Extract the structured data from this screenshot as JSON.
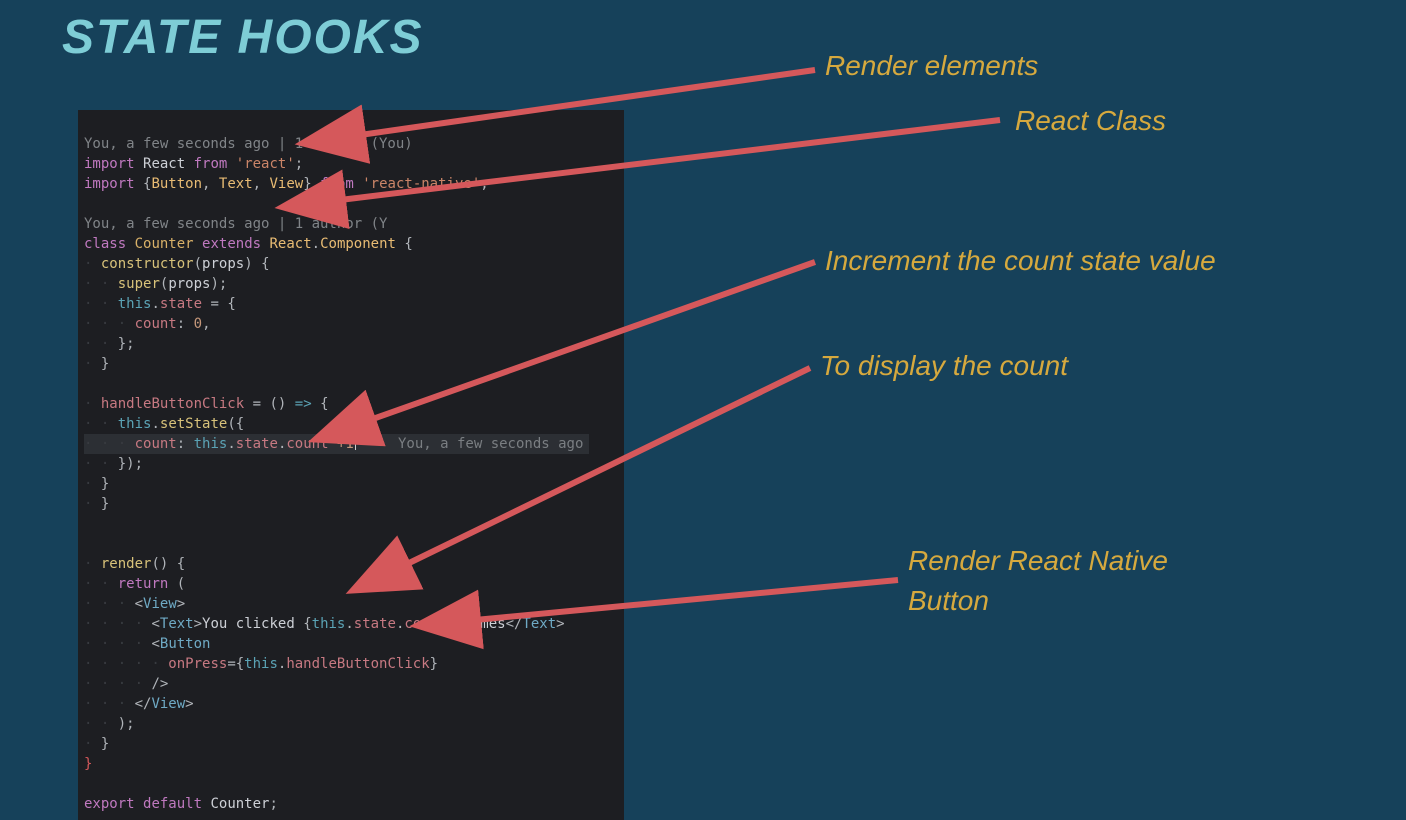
{
  "title": "STATE HOOKS",
  "labels": {
    "a": "Render elements",
    "b": "React Class",
    "c": "Increment the count state value",
    "d": "To display the count",
    "e1": "Render React Native",
    "e2": "Button"
  },
  "editor": {
    "anno1": "You, a few seconds ago | 1 author (You)",
    "anno2": "You, a few seconds ago | 1 author (Y",
    "annoInline": "You, a few seconds ago",
    "l1a": "import",
    "l1b": "React",
    "l1c": "from",
    "l1d": "'react'",
    "l2a": "import",
    "l2b": "Button",
    "l2c": "Text",
    "l2d": "View",
    "l2e": "from",
    "l2f": "'react-native'",
    "l3a": "class",
    "l3b": "Counter",
    "l3c": "extends",
    "l3d": "React",
    "l3e": "Component",
    "l4a": "constructor",
    "l4b": "props",
    "l5a": "super",
    "l5b": "props",
    "l6a": "this",
    "l6b": "state",
    "l7a": "count",
    "l7b": "0",
    "l8a": "handleButtonClick",
    "l9a": "this",
    "l9b": "setState",
    "l10a": "count",
    "l10b": "this",
    "l10c": "state",
    "l10d": "count",
    "l10e": "+1",
    "l11a": "render",
    "l12a": "return",
    "l13a": "View",
    "l14a": "Text",
    "l14b": "You clicked ",
    "l14c": "this",
    "l14d": "state",
    "l14e": "count",
    "l14f": " times",
    "l14g": "Text",
    "l15a": "Button",
    "l16a": "onPress",
    "l16b": "this",
    "l16c": "handleButtonClick",
    "l17a": "/>",
    "l18a": "View",
    "l19a": "export",
    "l19b": "default",
    "l19c": "Counter"
  }
}
